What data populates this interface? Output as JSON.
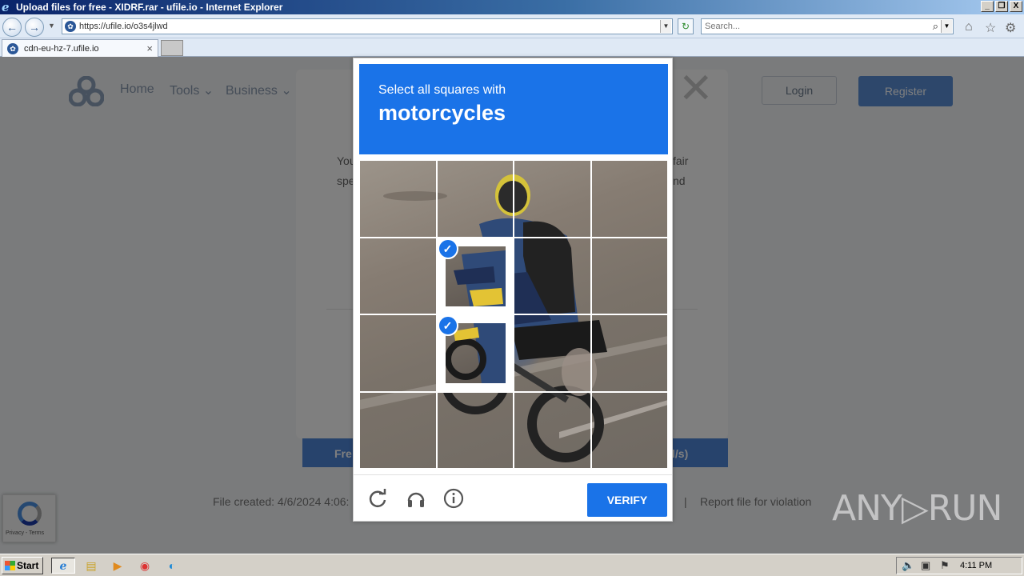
{
  "window": {
    "title": "Upload files for free - XIDRF.rar - ufile.io - Internet Explorer",
    "min": "_",
    "max": "❐",
    "close": "X"
  },
  "nav": {
    "back": "←",
    "forward": "→",
    "url": "https://ufile.io/o3s4jlwd",
    "go": "↻",
    "search_placeholder": "Search..."
  },
  "tab": {
    "label": "cdn-eu-hz-7.ufile.io",
    "close": "×"
  },
  "site": {
    "nav_home": "Home",
    "nav_tools": "Tools ⌄",
    "nav_business": "Business ⌄",
    "login": "Login",
    "register": "Register",
    "modal_close": "✕",
    "partial_text_1a": "You",
    "partial_text_1b": "fair",
    "partial_text_2a": "spe",
    "partial_text_2b": "nd",
    "free_left": "Fre",
    "free_right": "l/s)",
    "file_created": "File created: 4/6/2024 4:06:",
    "separator": "|",
    "report": "Report file for violation",
    "recaptcha_privacy": "Privacy - Terms"
  },
  "challenge": {
    "instruction": "Select all squares with",
    "target": "motorcycles",
    "selected_tiles": [
      5,
      9
    ],
    "verify_label": "VERIFY",
    "reload_icon": "reload-icon",
    "audio_icon": "headphones-icon",
    "info_icon": "info-icon"
  },
  "watermark": "ANY▷RUN",
  "taskbar": {
    "start": "Start",
    "clock": "4:11 PM"
  }
}
